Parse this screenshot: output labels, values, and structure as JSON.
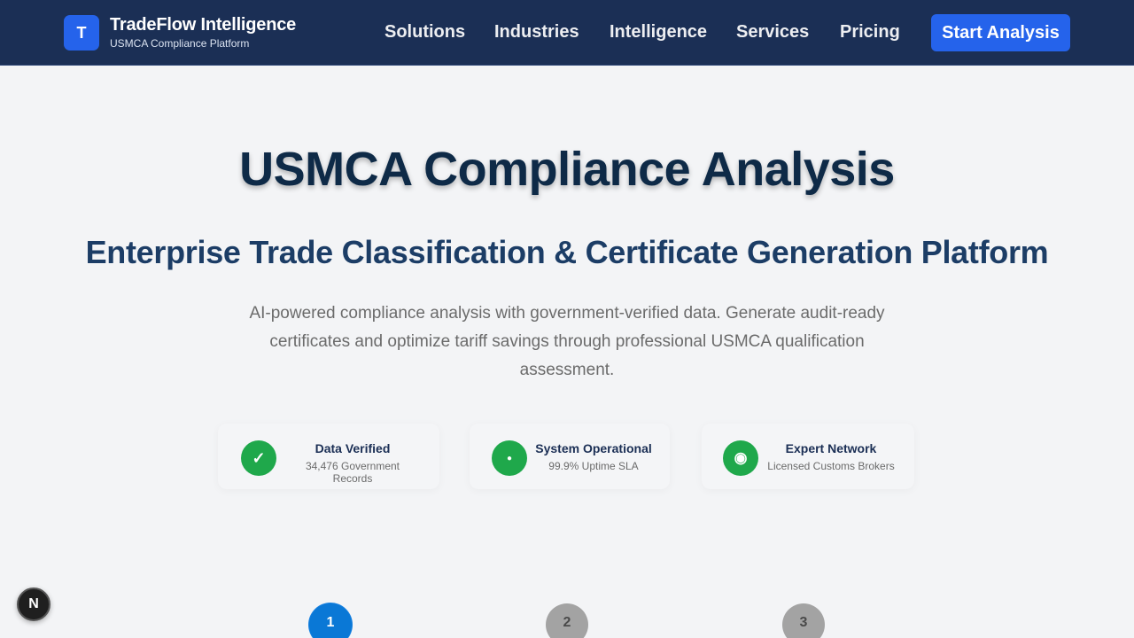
{
  "header": {
    "logo_letter": "T",
    "brand_name": "TradeFlow Intelligence",
    "brand_sub": "USMCA Compliance Platform",
    "nav": [
      "Solutions",
      "Industries",
      "Intelligence",
      "Services",
      "Pricing"
    ],
    "cta_label": "Start Analysis"
  },
  "hero": {
    "title": "USMCA Compliance Analysis",
    "subtitle": "Enterprise Trade Classification & Certificate Generation Platform",
    "description": "AI-powered compliance analysis with government-verified data. Generate audit-ready certificates and optimize tariff savings through professional USMCA qualification assessment."
  },
  "status_cards": [
    {
      "icon": "check-icon",
      "glyph": "✓",
      "title": "Data Verified",
      "text": "34,476 Government Records"
    },
    {
      "icon": "dot-icon",
      "glyph": "●",
      "title": "System Operational",
      "text": "99.9% Uptime SLA"
    },
    {
      "icon": "network-icon",
      "glyph": "◉",
      "title": "Expert Network",
      "text": "Licensed Customs Brokers"
    }
  ],
  "steps": [
    "1",
    "2",
    "3"
  ],
  "badge": {
    "letter": "N"
  },
  "colors": {
    "nav_bg": "#1b2f55",
    "accent": "#2563eb",
    "title": "#0e2a47",
    "subtitle": "#1c3d66",
    "success": "#1fa84b",
    "step_active": "#0a78d6",
    "step_inactive": "#a3a3a3"
  }
}
